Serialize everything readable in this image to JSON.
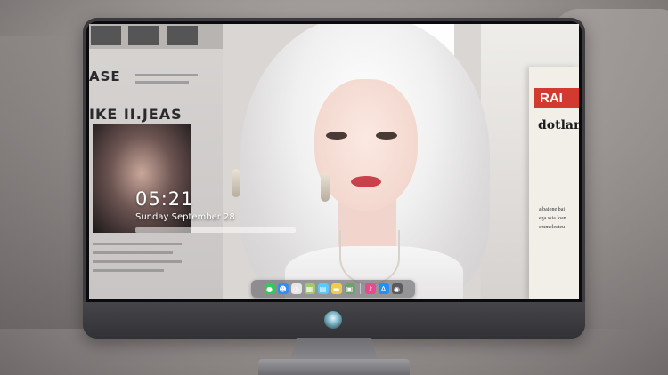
{
  "lockscreen": {
    "time": "05:21",
    "date": "Sunday September 28"
  },
  "wallpaper": {
    "headline_left_1": "ASE",
    "headline_left_2": "IKE II.JEAS",
    "paper_red": "RAI",
    "paper_head": "dotlan",
    "paper_text_1": "a baione bai",
    "paper_text_2": "ega ssia loan",
    "paper_text_3": "emmelecteu"
  },
  "dock": {
    "items": [
      {
        "name": "messages-icon",
        "glyph": "●",
        "color": "#35c759"
      },
      {
        "name": "finder-icon",
        "glyph": "☻",
        "color": "#2f8df5"
      },
      {
        "name": "clock-icon",
        "glyph": "◷",
        "color": "#e6e6e6"
      },
      {
        "name": "maps-icon",
        "glyph": "▦",
        "color": "#a4c86e"
      },
      {
        "name": "photos-icon",
        "glyph": "▤",
        "color": "#5ac8fa"
      },
      {
        "name": "notes-icon",
        "glyph": "▬",
        "color": "#f7c948"
      },
      {
        "name": "preview-icon",
        "glyph": "▣",
        "color": "#6f9f6d"
      },
      {
        "name": "music-icon",
        "glyph": "♪",
        "color": "#e64b8c"
      },
      {
        "name": "app-store-icon",
        "glyph": "A",
        "color": "#1e90ff"
      },
      {
        "name": "camera-icon",
        "glyph": "◉",
        "color": "#5a5a5f"
      }
    ]
  }
}
